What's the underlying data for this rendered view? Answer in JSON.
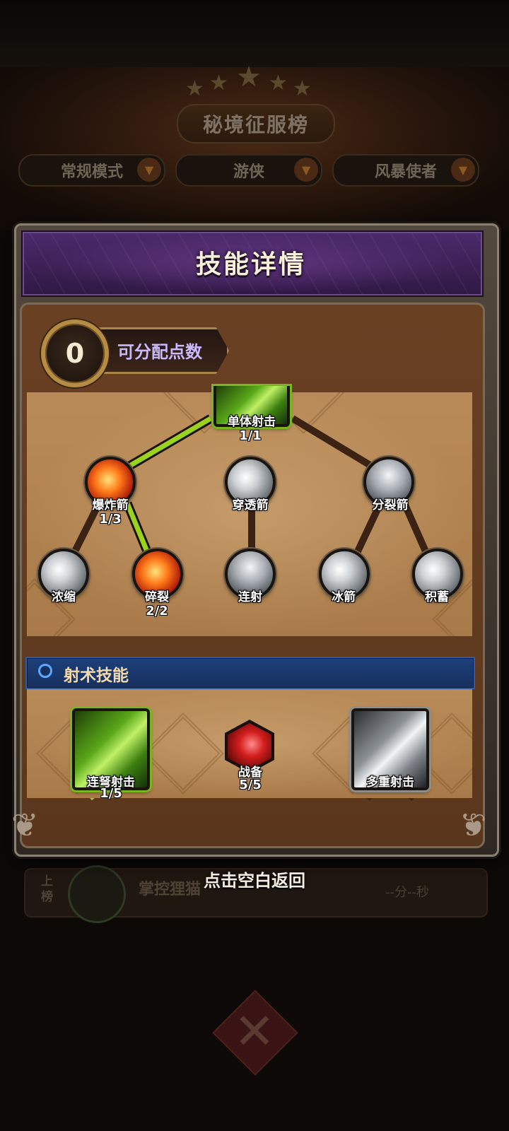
{
  "background": {
    "leaderboard_title": "秘境征服榜",
    "filters": [
      {
        "label": "常规模式"
      },
      {
        "label": "游侠"
      },
      {
        "label": "风暴使者"
      }
    ],
    "row": {
      "rank_label": "上\n榜",
      "name": "掌控狸猫",
      "time": "--分--秒"
    },
    "dropdown_arrow": "▼",
    "cross_glyph": "✕"
  },
  "dialog": {
    "title": "技能详情",
    "points": {
      "value": "0",
      "label": "可分配点数"
    },
    "tree_nodes": {
      "root": {
        "name": "单体射击",
        "level": "1/1",
        "icon": "green-arrow-icon"
      },
      "explosive": {
        "name": "爆炸箭",
        "level": "1/3",
        "icon": "fire-burst-icon"
      },
      "piercing": {
        "name": "穿透箭",
        "level": "",
        "icon": "silver-sphere-icon"
      },
      "split": {
        "name": "分裂箭",
        "level": "",
        "icon": "silver-claw-icon"
      },
      "concentrate": {
        "name": "浓缩",
        "level": "",
        "icon": "spark-burst-icon"
      },
      "shatter": {
        "name": "碎裂",
        "level": "2/2",
        "icon": "fire-explosion-icon"
      },
      "rapid": {
        "name": "连射",
        "level": "",
        "icon": "silver-streak-icon"
      },
      "ice": {
        "name": "冰箭",
        "level": "",
        "icon": "ice-arrow-icon"
      },
      "charge": {
        "name": "积蓄",
        "level": "",
        "icon": "light-orb-icon"
      }
    },
    "section": {
      "title": "射术技能"
    },
    "skills": {
      "crossbow": {
        "name": "连弩射击",
        "level": "1/5",
        "icon": "green-volley-icon"
      },
      "ready": {
        "name": "战备",
        "level": "5/5",
        "icon": "red-hex-icon"
      },
      "multi": {
        "name": "多重射击",
        "level": "",
        "icon": "silver-volley-icon"
      }
    },
    "close_hint": "点击空白返回"
  },
  "colors": {
    "active_link": "#9bd21f",
    "inactive_link": "#3b2212",
    "header_purple": "#3d2157",
    "points_text": "#c9b9ff",
    "section_blue": "#1e3f7a"
  }
}
